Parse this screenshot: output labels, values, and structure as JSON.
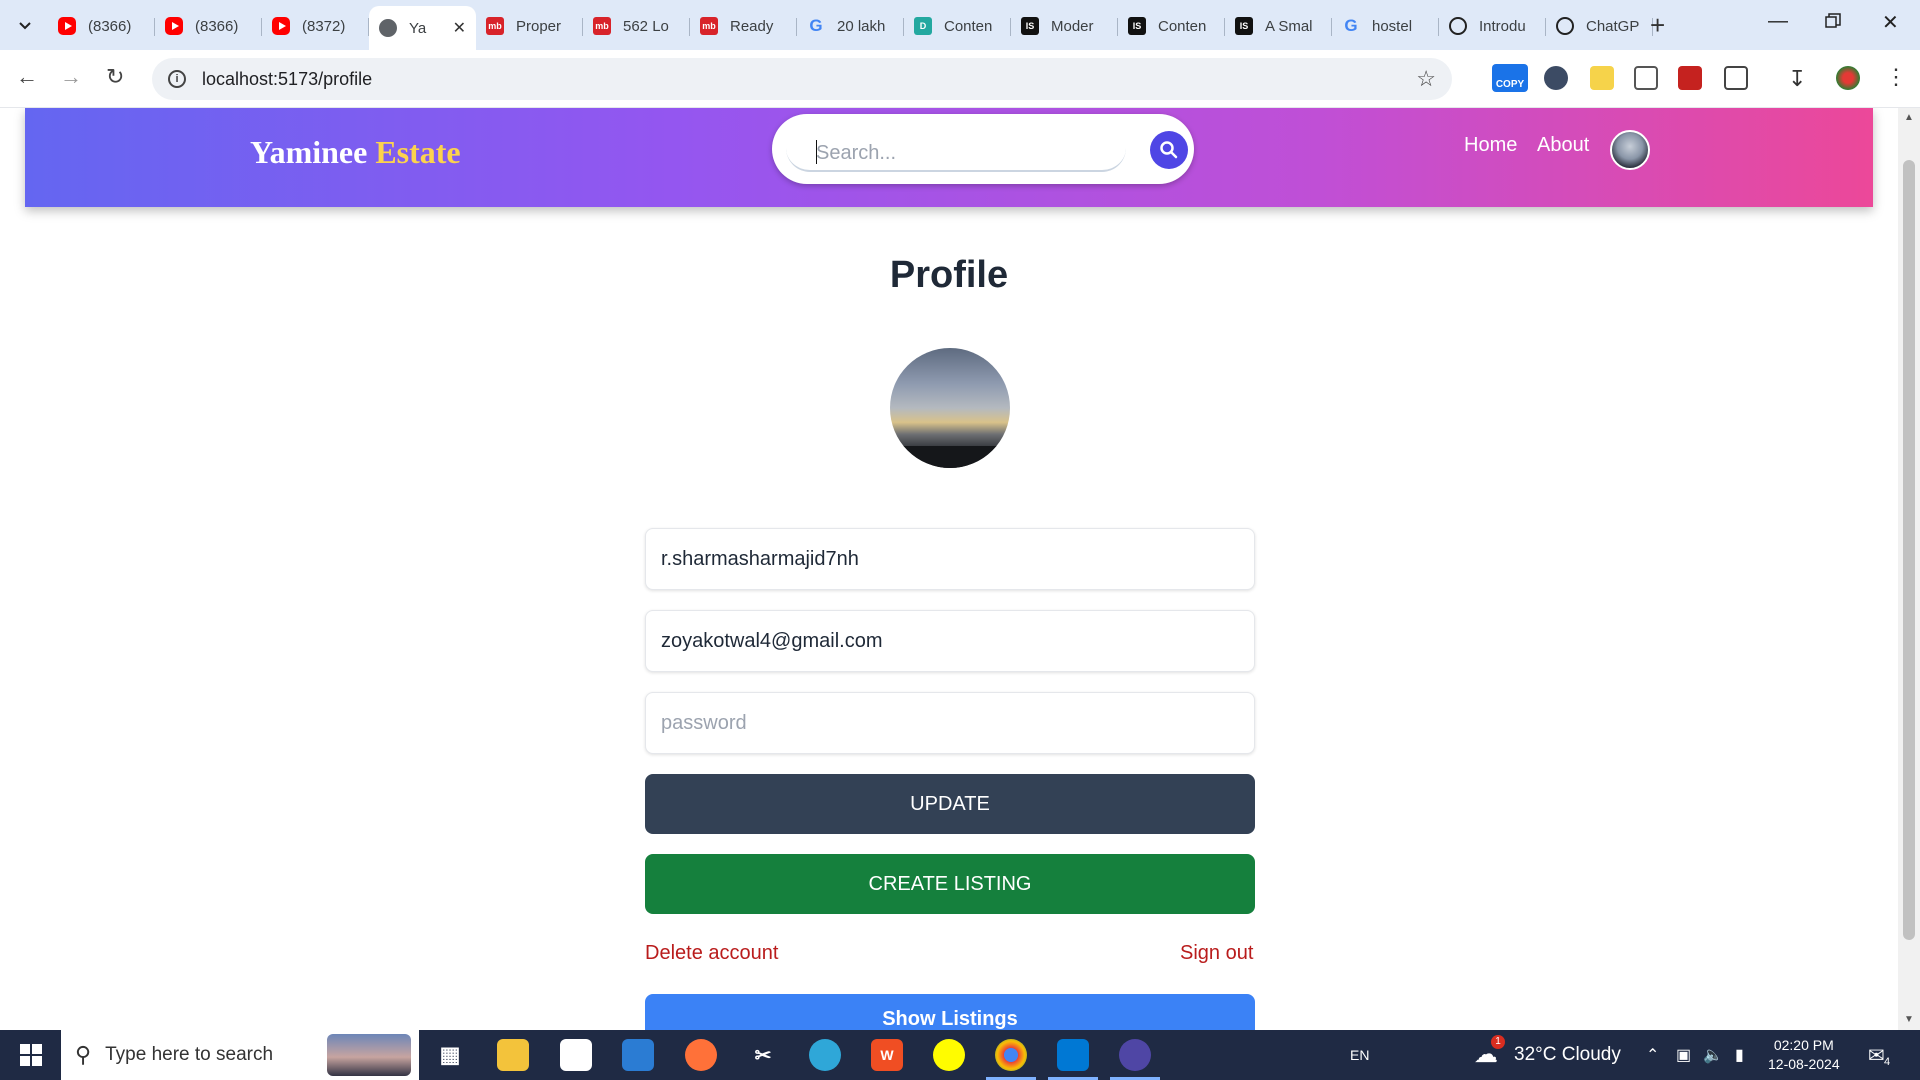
{
  "browser": {
    "tabs": [
      {
        "title": "(8366)",
        "icon": "youtube-icon"
      },
      {
        "title": "(8366)",
        "icon": "youtube-icon"
      },
      {
        "title": "(8372)",
        "icon": "youtube-icon"
      },
      {
        "title": "Ya",
        "icon": "globe-icon",
        "active": true
      },
      {
        "title": "Proper",
        "icon": "magicbricks-icon"
      },
      {
        "title": "562 Lo",
        "icon": "magicbricks-icon"
      },
      {
        "title": "Ready",
        "icon": "magicbricks-icon"
      },
      {
        "title": "20 lakh",
        "icon": "google-icon"
      },
      {
        "title": "Conten",
        "icon": "d-icon"
      },
      {
        "title": "Moder",
        "icon": "is-icon"
      },
      {
        "title": "Conten",
        "icon": "is-icon"
      },
      {
        "title": "A Smal",
        "icon": "is-icon"
      },
      {
        "title": "hostel",
        "icon": "google-icon"
      },
      {
        "title": "Introdu",
        "icon": "openai-icon"
      },
      {
        "title": "ChatGP",
        "icon": "openai-icon"
      }
    ],
    "url": "localhost:5173/profile",
    "extension_copy_label": "COPY"
  },
  "header": {
    "brand_first": "Yaminee",
    "brand_second": "Estate",
    "search_placeholder": "Search...",
    "nav_home": "Home",
    "nav_about": "About"
  },
  "profile": {
    "title": "Profile",
    "username_value": "r.sharmasharmajid7nh",
    "email_value": "zoyakotwal4@gmail.com",
    "password_placeholder": "password",
    "update_label": "UPDATE",
    "create_listing_label": "CREATE LISTING",
    "delete_account_label": "Delete account",
    "sign_out_label": "Sign out",
    "show_listings_label": "Show Listings"
  },
  "colors": {
    "header_gradient_start": "#6466f1",
    "header_gradient_end": "#ec4899",
    "brand_accent": "#fcd34d",
    "update_button": "#334155",
    "create_button": "#15803d",
    "show_listings_button": "#3b82f6",
    "danger_link": "#b91c1c"
  },
  "taskbar": {
    "search_placeholder": "Type here to search",
    "language": "EN",
    "weather": "32°C  Cloudy",
    "weather_badge": "1",
    "time": "02:20 PM",
    "date": "12-08-2024",
    "notification_count": "4"
  }
}
